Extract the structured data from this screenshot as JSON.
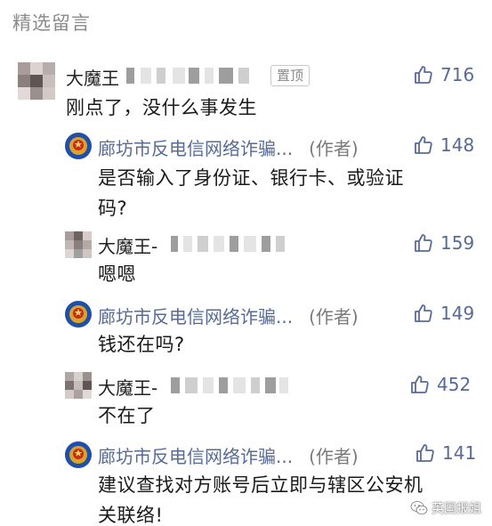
{
  "section_title": "精选留言",
  "pin_label": "置顶",
  "watermark": "英国报姐",
  "comment": {
    "name": "大魔王",
    "text": "刚点了，没什么事发生",
    "likes": "716"
  },
  "replies": [
    {
      "name": "廊坊市反电信网络诈骗...",
      "role": "(作者)",
      "likes": "148",
      "lines": [
        "是否输入了身份证、银行卡、或验证",
        "码?"
      ]
    },
    {
      "name": "大魔王-",
      "likes": "159",
      "lines": [
        "嗯嗯"
      ]
    },
    {
      "name": "廊坊市反电信网络诈骗...",
      "role": "(作者)",
      "likes": "149",
      "lines": [
        "钱还在吗?"
      ]
    },
    {
      "name": "大魔王-",
      "likes": "452",
      "lines": [
        "不在了"
      ]
    },
    {
      "name": "廊坊市反电信网络诈骗...",
      "role": "(作者)",
      "likes": "141",
      "lines": [
        "建议查找对方账号后立即与辖区公安机",
        "关联络!"
      ]
    }
  ],
  "icons": {
    "like": "thumbs-up-icon",
    "police": "police-emblem-icon",
    "watermark": "wechat-icon"
  },
  "colors": {
    "author_name": "#576b95",
    "like": "#576b95",
    "section_title": "#8a8a8a"
  }
}
